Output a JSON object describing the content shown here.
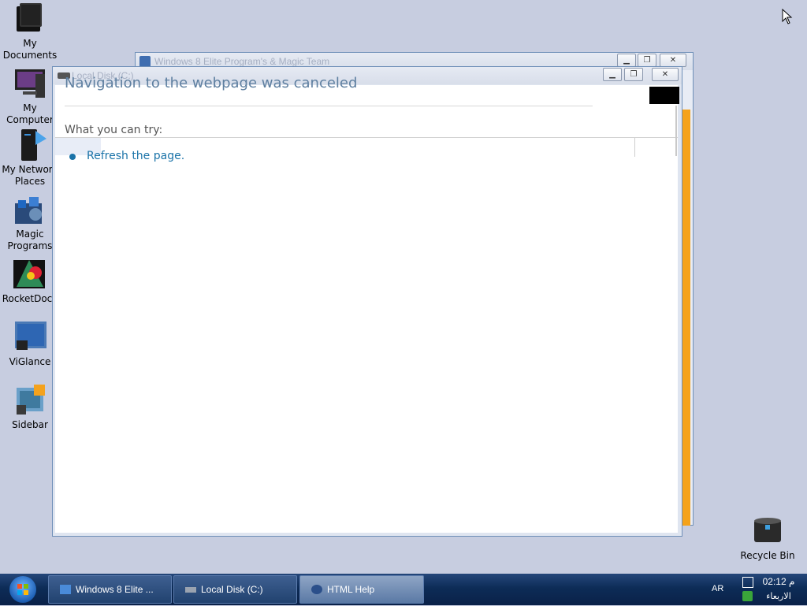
{
  "desktop": {
    "icons": [
      {
        "label": "My\nDocuments",
        "icon": "folder-documents-icon"
      },
      {
        "label": "My Computer",
        "icon": "computer-icon"
      },
      {
        "label": "My Network\nPlaces",
        "icon": "network-icon"
      },
      {
        "label": "Magic\nPrograms",
        "icon": "magic-programs-icon"
      },
      {
        "label": "RocketDock",
        "icon": "rocketdock-icon"
      },
      {
        "label": "ViGlance",
        "icon": "viglance-icon"
      },
      {
        "label": "Sidebar",
        "icon": "sidebar-icon"
      }
    ],
    "recycle_bin": {
      "label": "Recycle Bin",
      "icon": "recycle-bin-icon"
    }
  },
  "back_window": {
    "title": "Windows 8 Elite Program's & Magic Team"
  },
  "front_window": {
    "title": "Local Disk (C:)",
    "heading": "Navigation to the webpage was canceled",
    "what_you_can_try": "What you can try:",
    "link": "Refresh the page."
  },
  "taskbar": {
    "tasks": [
      {
        "label": "Windows 8 Elite ...",
        "icon": "ie-icon"
      },
      {
        "label": "Local Disk (C:)",
        "icon": "drive-icon"
      },
      {
        "label": "HTML Help",
        "icon": "help-icon"
      }
    ],
    "language": "AR",
    "time": "02:12 م",
    "day": "الاربعاء"
  },
  "colors": {
    "desktop": "#c7cde0",
    "taskbar": "#0d2c57",
    "link": "#1a73a8",
    "orange_edge": "#f5a21a"
  }
}
